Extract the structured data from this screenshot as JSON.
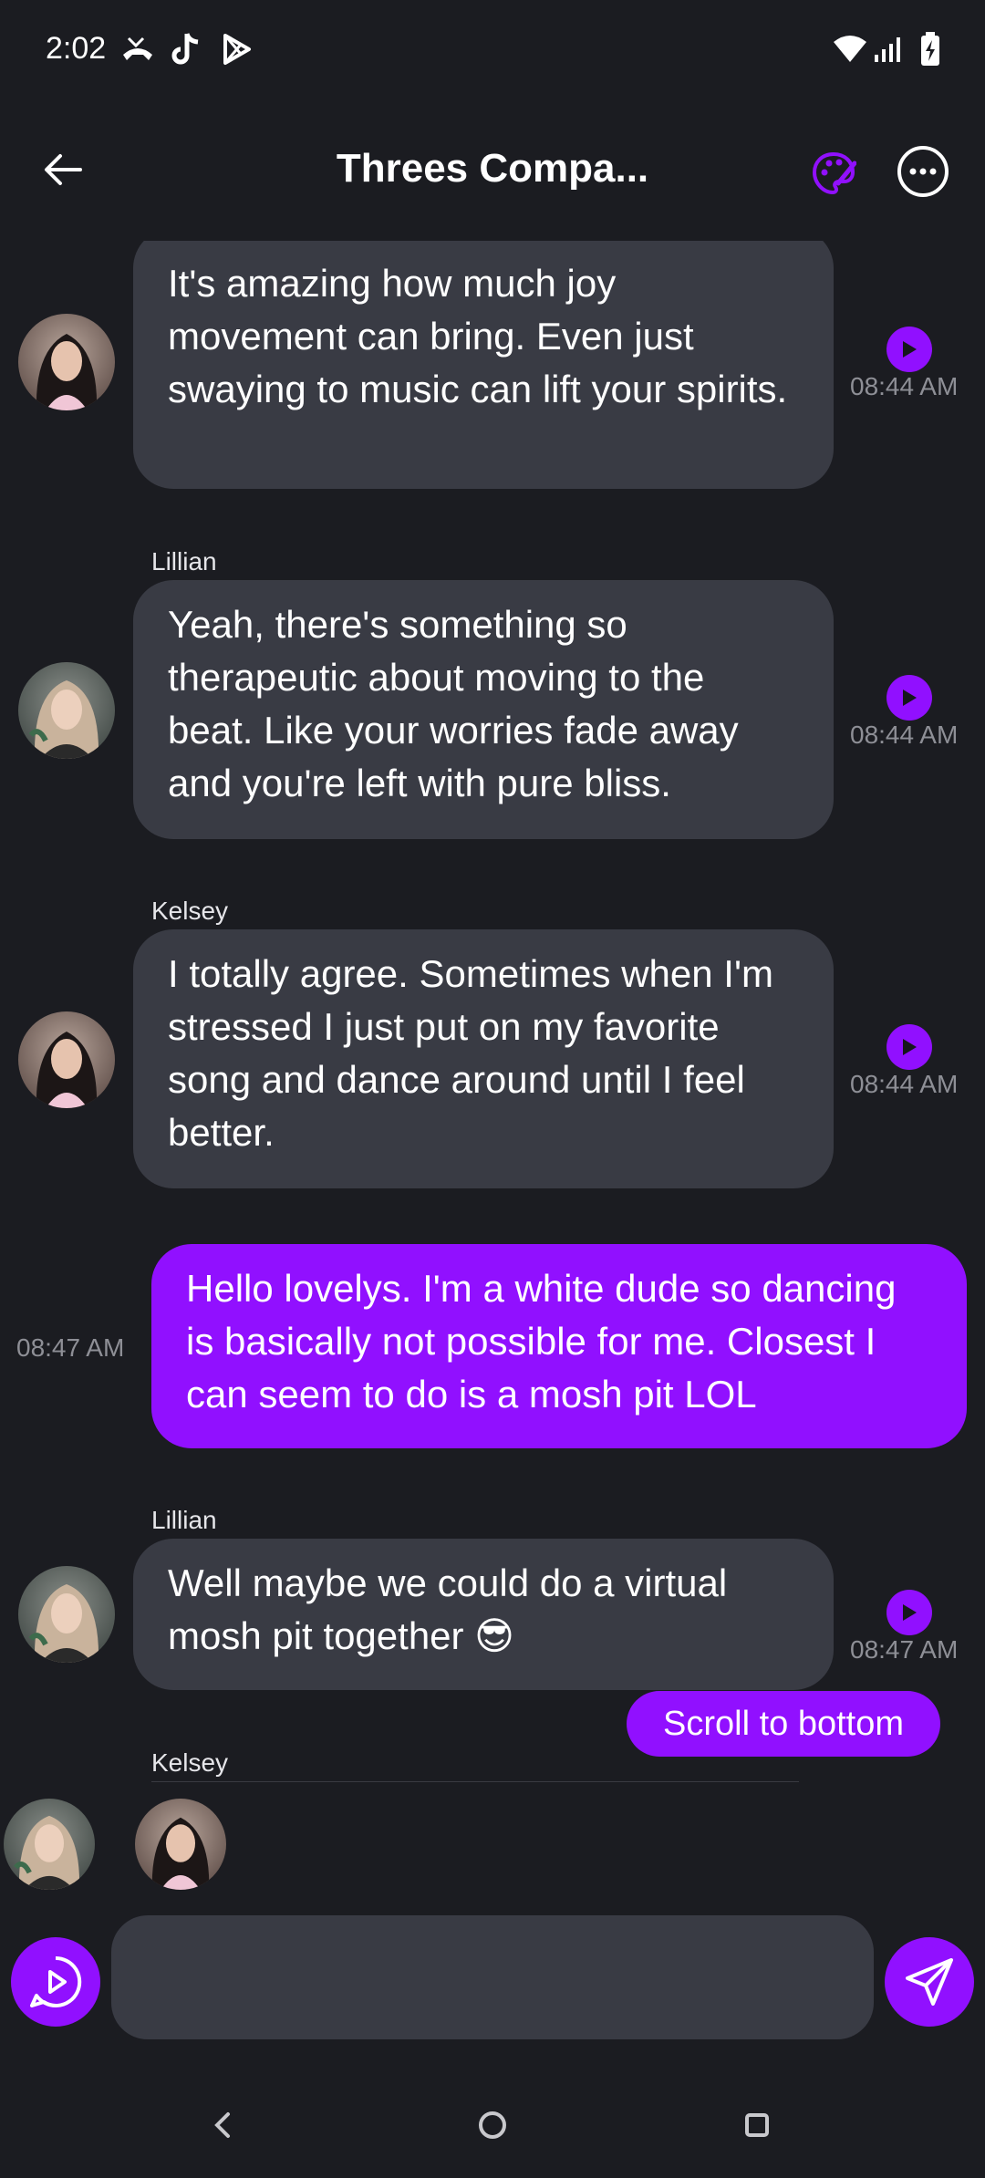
{
  "status_bar": {
    "time": "2:02",
    "icons": [
      "missed-call-icon",
      "tiktok-icon",
      "play-store-icon",
      "wifi-icon",
      "signal-icon",
      "battery-charging-icon"
    ]
  },
  "header": {
    "title": "Threes Compa...",
    "back_icon": "arrow-left-icon",
    "palette_icon": "palette-icon",
    "more_icon": "more-horizontal-icon"
  },
  "colors": {
    "accent": "#9110ff",
    "background": "#1b1c21",
    "bubble": "#393b44",
    "muted_text": "#8e8f96"
  },
  "messages": [
    {
      "sender": "",
      "text": "It's amazing how much joy movement can bring. Even just swaying to music can lift your spirits.",
      "time": "08:44 AM",
      "own": false,
      "avatar": "kelsey-avatar"
    },
    {
      "sender": "Lillian",
      "text": "Yeah, there's something so therapeutic about moving to the beat. Like your worries fade away and you're left with pure bliss.",
      "time": "08:44 AM",
      "own": false,
      "avatar": "lillian-avatar"
    },
    {
      "sender": "Kelsey",
      "text": "I totally agree. Sometimes when I'm stressed I just put on my favorite song and dance around until I feel better.",
      "time": "08:44 AM",
      "own": false,
      "avatar": "kelsey-avatar"
    },
    {
      "sender": "",
      "text": "Hello lovelys. I'm a white dude so dancing is basically not possible for me. Closest I can seem to do is a mosh pit LOL",
      "time": "08:47 AM",
      "own": true
    },
    {
      "sender": "Lillian",
      "text": "Well maybe we could do a virtual mosh pit together 😎",
      "time": "08:47 AM",
      "own": false,
      "avatar": "lillian-avatar"
    },
    {
      "sender": "Kelsey",
      "text": "",
      "own": false
    }
  ],
  "scroll_button": {
    "label": "Scroll to bottom"
  },
  "typing_avatars": [
    "lillian-avatar",
    "kelsey-avatar"
  ],
  "composer": {
    "placeholder": "",
    "voice_icon": "voice-chat-icon",
    "send_icon": "send-icon"
  },
  "nav": {
    "back_icon": "nav-back-icon",
    "home_icon": "nav-home-icon",
    "recents_icon": "nav-recents-icon"
  }
}
